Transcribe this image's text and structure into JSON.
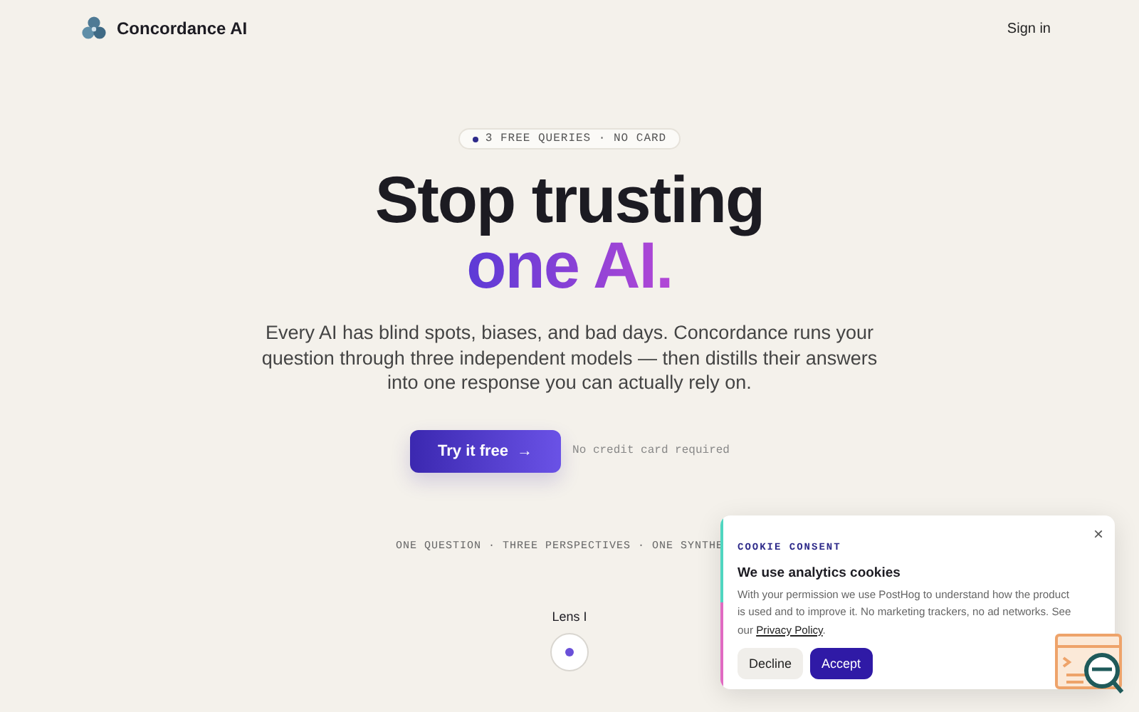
{
  "header": {
    "brand": "Concordance AI",
    "sign_in": "Sign in"
  },
  "hero": {
    "badge": "3 FREE QUERIES · NO CARD",
    "title_line_1": "Stop trusting",
    "title_line_2": "one AI.",
    "description": "Every AI has blind spots, biases, and bad days. Concordance runs your question through three independent models — then distills their answers into one response you can actually rely on.",
    "cta": "Try it free",
    "cta_arrow": "→",
    "cta_note": "No credit card required"
  },
  "tagline": "ONE QUESTION · THREE PERSPECTIVES · ONE SYNTHE",
  "lens": {
    "label": "Lens I"
  },
  "cookie_consent": {
    "eyebrow": "COOKIE CONSENT",
    "close": "×",
    "title": "We use analytics cookies",
    "text": "With your permission we use PostHog to understand how the product is used and to improve it. No marketing trackers, no ad networks. See our ",
    "link": "Privacy Policy",
    "text_end": ".",
    "buttons": [
      {
        "label": "Decline",
        "kind": "secondary"
      },
      {
        "label": "Accept",
        "kind": "primary"
      }
    ]
  }
}
